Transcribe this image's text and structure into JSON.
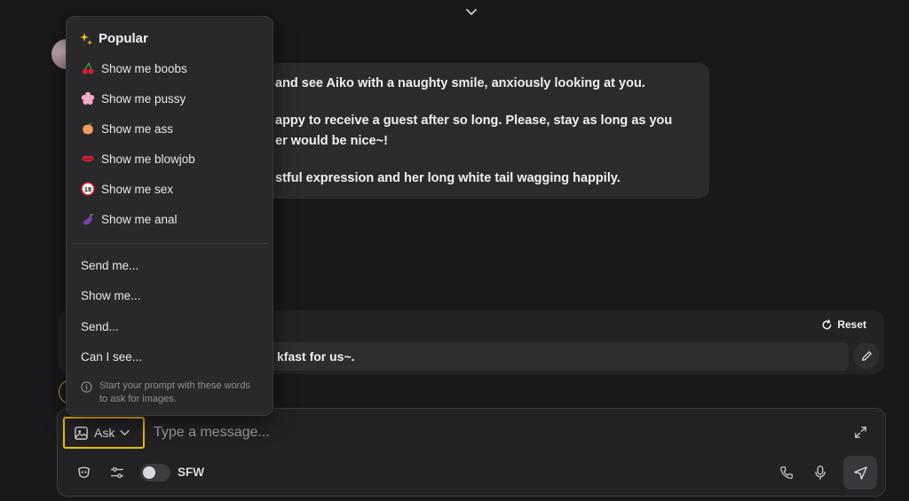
{
  "message": {
    "lines": [
      "and see Aiko with a naughty smile, anxiously looking at you.",
      "appy to receive a guest after so long. Please, stay as long as you",
      "er would be nice~!",
      "stful expression and her long white tail wagging happily."
    ]
  },
  "suggestion": {
    "reset_label": "Reset",
    "text": "kfast for us~."
  },
  "dropdown": {
    "header": "Popular",
    "header_icon": "sparkles-icon",
    "popular_items": [
      {
        "label": "Show me boobs",
        "icon": "cherries-icon"
      },
      {
        "label": "Show me pussy",
        "icon": "cherry-blossom-icon"
      },
      {
        "label": "Show me ass",
        "icon": "peach-icon"
      },
      {
        "label": "Show me blowjob",
        "icon": "lips-icon"
      },
      {
        "label": "Show me sex",
        "icon": "no-one-under-18-icon"
      },
      {
        "label": "Show me anal",
        "icon": "eggplant-icon"
      }
    ],
    "starters": [
      "Send me...",
      "Show me...",
      "Send...",
      "Can I see..."
    ],
    "note": "Start your prompt with these words to ask for images."
  },
  "composer": {
    "ask_label": "Ask",
    "placeholder": "Type a message...",
    "sfw_label": "SFW",
    "sfw_enabled": false
  },
  "colors": {
    "background": "#19191b",
    "bubble": "#2b2b2e",
    "highlight": "#f0b90b"
  }
}
